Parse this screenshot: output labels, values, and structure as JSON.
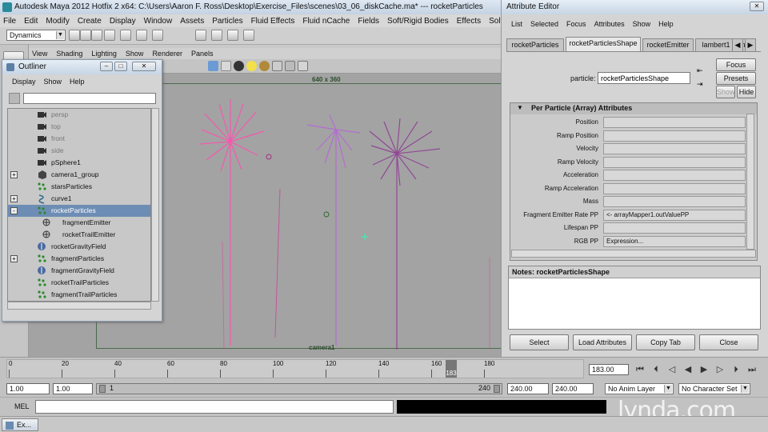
{
  "window_title": "Autodesk Maya 2012 Hotfix 2 x64: C:\\Users\\Aaron F. Ross\\Desktop\\Exercise_Files\\scenes\\03_06_diskCache.ma*  ---  rocketParticles",
  "menu": [
    "File",
    "Edit",
    "Modify",
    "Create",
    "Display",
    "Window",
    "Assets",
    "Particles",
    "Fluid Effects",
    "Fluid nCache",
    "Fields",
    "Soft/Rigid Bodies",
    "Effects",
    "Solvers",
    "Hair",
    "Muscle"
  ],
  "menu_set": "Dynamics",
  "panel_menu": [
    "View",
    "Shading",
    "Lighting",
    "Show",
    "Renderer",
    "Panels"
  ],
  "viewport": {
    "resolution": "640 x 360",
    "camera": "camera1"
  },
  "outliner": {
    "title": "Outliner",
    "menu": [
      "Display",
      "Show",
      "Help"
    ],
    "filter": "",
    "items": [
      {
        "label": "persp",
        "icon": "camera-icon",
        "expand": "",
        "selected": false,
        "dim": true
      },
      {
        "label": "top",
        "icon": "camera-icon",
        "expand": "",
        "selected": false,
        "dim": true
      },
      {
        "label": "front",
        "icon": "camera-icon",
        "expand": "",
        "selected": false,
        "dim": true
      },
      {
        "label": "side",
        "icon": "camera-icon",
        "expand": "",
        "selected": false,
        "dim": true
      },
      {
        "label": "pSphere1",
        "icon": "camera-icon",
        "expand": "",
        "selected": false,
        "dim": false
      },
      {
        "label": "camera1_group",
        "icon": "group-icon",
        "expand": "+",
        "selected": false,
        "dim": false
      },
      {
        "label": "starsParticles",
        "icon": "particles-icon",
        "expand": "",
        "selected": false,
        "dim": false
      },
      {
        "label": "curve1",
        "icon": "curve-icon",
        "expand": "+",
        "selected": false,
        "dim": false
      },
      {
        "label": "rocketParticles",
        "icon": "particles-icon",
        "expand": "-",
        "selected": true,
        "dim": false
      },
      {
        "label": "fragmentEmitter",
        "icon": "emitter-icon",
        "expand": "",
        "selected": false,
        "dim": false,
        "child": true
      },
      {
        "label": "rocketTrailEmitter",
        "icon": "emitter-icon",
        "expand": "",
        "selected": false,
        "dim": false,
        "child": true
      },
      {
        "label": "rocketGravityField",
        "icon": "field-icon",
        "expand": "",
        "selected": false,
        "dim": false
      },
      {
        "label": "fragmentParticles",
        "icon": "particles-icon",
        "expand": "+",
        "selected": false,
        "dim": false
      },
      {
        "label": "fragmentGravityField",
        "icon": "field-icon",
        "expand": "",
        "selected": false,
        "dim": false
      },
      {
        "label": "rocketTrailParticles",
        "icon": "particles-icon",
        "expand": "",
        "selected": false,
        "dim": false
      },
      {
        "label": "fragmentTrailParticles",
        "icon": "particles-icon",
        "expand": "",
        "selected": false,
        "dim": false
      }
    ]
  },
  "attribute_editor": {
    "title": "Attribute Editor",
    "menu": [
      "List",
      "Selected",
      "Focus",
      "Attributes",
      "Show",
      "Help"
    ],
    "tabs": [
      "rocketParticles",
      "rocketParticlesShape",
      "rocketEmitter",
      "lambert1",
      "n"
    ],
    "active_tab": 1,
    "node_type": "particle:",
    "node_name": "rocketParticlesShape",
    "buttons": {
      "focus": "Focus",
      "presets": "Presets",
      "show": "Show",
      "hide": "Hide"
    },
    "section": "Per Particle (Array) Attributes",
    "attributes": [
      {
        "name": "Position",
        "value": ""
      },
      {
        "name": "Ramp Position",
        "value": ""
      },
      {
        "name": "Velocity",
        "value": ""
      },
      {
        "name": "Ramp Velocity",
        "value": ""
      },
      {
        "name": "Acceleration",
        "value": ""
      },
      {
        "name": "Ramp Acceleration",
        "value": ""
      },
      {
        "name": "Mass",
        "value": ""
      },
      {
        "name": "Fragment Emitter Rate PP",
        "value": "<- arrayMapper1.outValuePP"
      },
      {
        "name": "Lifespan PP",
        "value": ""
      },
      {
        "name": "RGB PP",
        "value": "Expression..."
      }
    ],
    "notes_label": "Notes:  rocketParticlesShape",
    "bottom_buttons": [
      "Select",
      "Load Attributes",
      "Copy Tab",
      "Close"
    ]
  },
  "timeline": {
    "ticks": [
      "0",
      "20",
      "40",
      "60",
      "80",
      "100",
      "120",
      "140",
      "160",
      "180"
    ],
    "current_frame": "183",
    "current_time_field": "183.00"
  },
  "range": {
    "start": "1.00",
    "playback_start": "1.00",
    "slider_start": "1",
    "slider_end": "240",
    "playback_end": "240.00",
    "end": "240.00",
    "anim_layer": "No Anim Layer",
    "char_set": "No Character Set"
  },
  "command_line": {
    "label": "MEL",
    "value": ""
  },
  "taskbar_item": "Ex...",
  "watermark": "lynda.com"
}
